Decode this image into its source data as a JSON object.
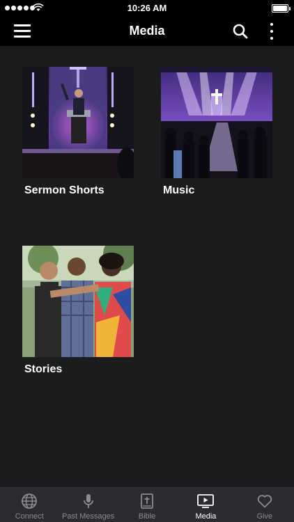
{
  "status_bar": {
    "time": "10:26 AM"
  },
  "header": {
    "title": "Media"
  },
  "tiles": [
    {
      "label": "Sermon Shorts"
    },
    {
      "label": "Music"
    },
    {
      "label": "Stories"
    }
  ],
  "tab_bar": {
    "tabs": [
      {
        "label": "Connect",
        "icon": "globe-icon",
        "active": false
      },
      {
        "label": "Past Messages",
        "icon": "microphone-icon",
        "active": false
      },
      {
        "label": "Bible",
        "icon": "bible-icon",
        "active": false
      },
      {
        "label": "Media",
        "icon": "play-screen-icon",
        "active": true
      },
      {
        "label": "Give",
        "icon": "heart-icon",
        "active": false
      }
    ]
  },
  "colors": {
    "background": "#1b1c1e",
    "bar": "#000000",
    "tab_bar": "#2b2c2f",
    "tab_inactive": "#8b8c8f",
    "tab_active": "#ffffff"
  }
}
